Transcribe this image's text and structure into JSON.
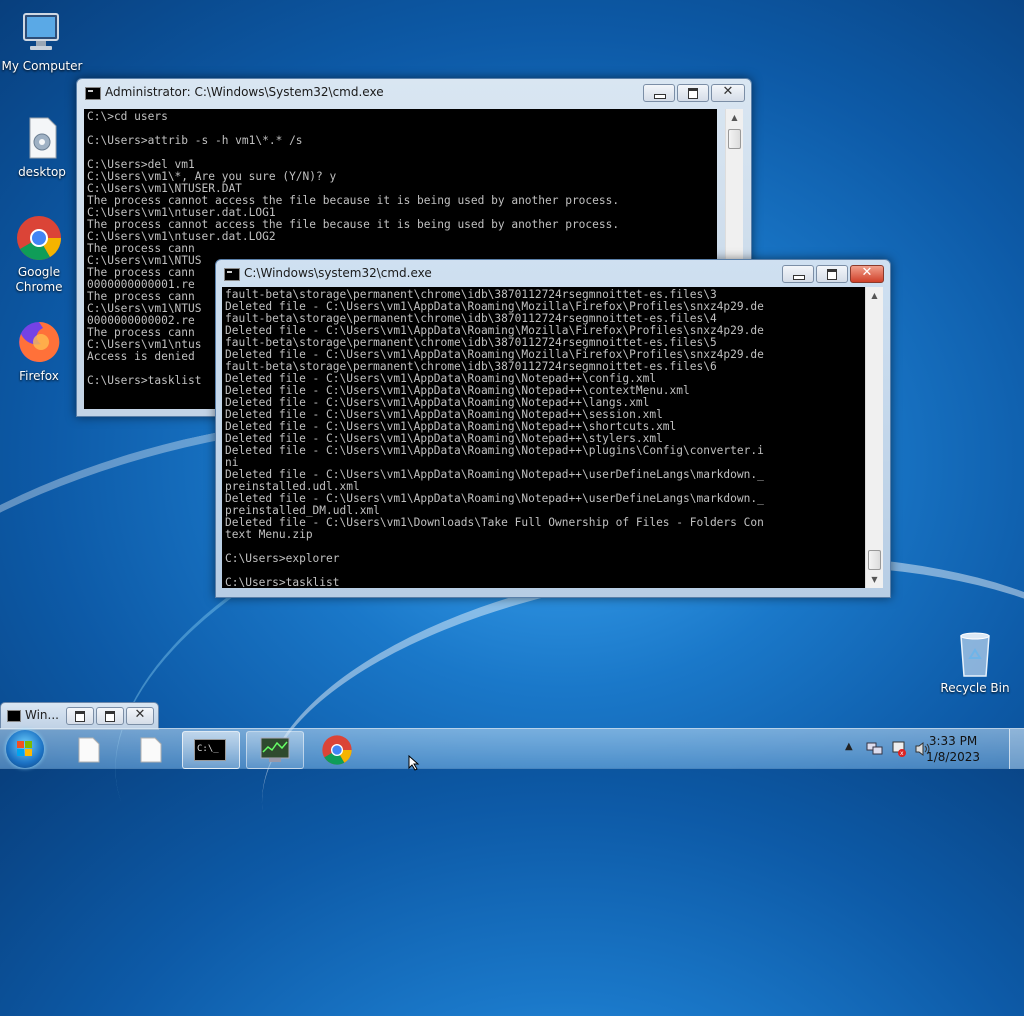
{
  "desktop_icons": [
    {
      "label": "My Computer",
      "icon": "computer-icon"
    },
    {
      "label": "desktop",
      "icon": "settings-file-icon"
    },
    {
      "label": "Google Chrome",
      "icon": "chrome-icon"
    },
    {
      "label": "Firefox",
      "icon": "firefox-icon"
    },
    {
      "label": "Recycle Bin",
      "icon": "recycle-bin-icon"
    }
  ],
  "window_back": {
    "title": "Administrator: C:\\Windows\\System32\\cmd.exe",
    "lines": "C:\\>cd users\n\nC:\\Users>attrib -s -h vm1\\*.* /s\n\nC:\\Users>del vm1\nC:\\Users\\vm1\\*, Are you sure (Y/N)? y\nC:\\Users\\vm1\\NTUSER.DAT\nThe process cannot access the file because it is being used by another process.\nC:\\Users\\vm1\\ntuser.dat.LOG1\nThe process cannot access the file because it is being used by another process.\nC:\\Users\\vm1\\ntuser.dat.LOG2\nThe process cann\nC:\\Users\\vm1\\NTUS\nThe process cann\n0000000000001.re\nThe process cann\nC:\\Users\\vm1\\NTUS\n0000000000002.re\nThe process cann\nC:\\Users\\vm1\\ntus\nAccess is denied\n\nC:\\Users>tasklist"
  },
  "window_front": {
    "title": "C:\\Windows\\system32\\cmd.exe",
    "lines": "fault-beta\\storage\\permanent\\chrome\\idb\\3870112724rsegmnoittet-es.files\\3\nDeleted file - C:\\Users\\vm1\\AppData\\Roaming\\Mozilla\\Firefox\\Profiles\\snxz4p29.de\nfault-beta\\storage\\permanent\\chrome\\idb\\3870112724rsegmnoittet-es.files\\4\nDeleted file - C:\\Users\\vm1\\AppData\\Roaming\\Mozilla\\Firefox\\Profiles\\snxz4p29.de\nfault-beta\\storage\\permanent\\chrome\\idb\\3870112724rsegmnoittet-es.files\\5\nDeleted file - C:\\Users\\vm1\\AppData\\Roaming\\Mozilla\\Firefox\\Profiles\\snxz4p29.de\nfault-beta\\storage\\permanent\\chrome\\idb\\3870112724rsegmnoittet-es.files\\6\nDeleted file - C:\\Users\\vm1\\AppData\\Roaming\\Notepad++\\config.xml\nDeleted file - C:\\Users\\vm1\\AppData\\Roaming\\Notepad++\\contextMenu.xml\nDeleted file - C:\\Users\\vm1\\AppData\\Roaming\\Notepad++\\langs.xml\nDeleted file - C:\\Users\\vm1\\AppData\\Roaming\\Notepad++\\session.xml\nDeleted file - C:\\Users\\vm1\\AppData\\Roaming\\Notepad++\\shortcuts.xml\nDeleted file - C:\\Users\\vm1\\AppData\\Roaming\\Notepad++\\stylers.xml\nDeleted file - C:\\Users\\vm1\\AppData\\Roaming\\Notepad++\\plugins\\Config\\converter.i\nni\nDeleted file - C:\\Users\\vm1\\AppData\\Roaming\\Notepad++\\userDefineLangs\\markdown._\npreinstalled.udl.xml\nDeleted file - C:\\Users\\vm1\\AppData\\Roaming\\Notepad++\\userDefineLangs\\markdown._\npreinstalled_DM.udl.xml\nDeleted file - C:\\Users\\vm1\\Downloads\\Take Full Ownership of Files - Folders Con\ntext Menu.zip\n\nC:\\Users>explorer\n\nC:\\Users>tasklist"
  },
  "minimized_window": {
    "title": "Win..."
  },
  "taskbar": {
    "items": [
      {
        "name": "file-icon"
      },
      {
        "name": "file-icon"
      },
      {
        "name": "cmd-icon",
        "state": "active"
      },
      {
        "name": "task-manager-icon",
        "state": "open"
      },
      {
        "name": "chrome-icon"
      }
    ],
    "time": "3:33 PM",
    "date": "1/8/2023"
  },
  "colors": {
    "console_bg": "#000000",
    "console_fg": "#c0c0c0",
    "close_button": "#c9503a"
  }
}
